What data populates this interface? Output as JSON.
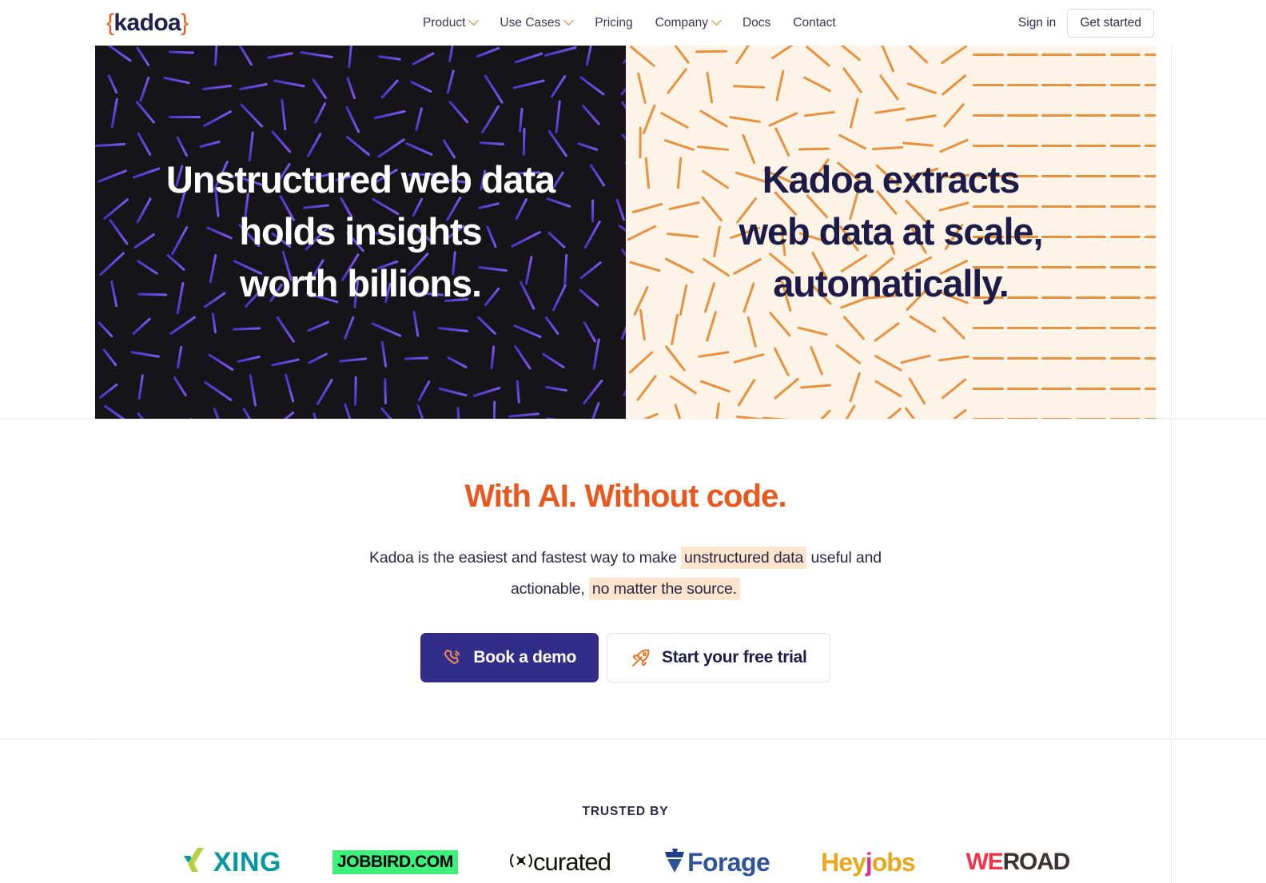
{
  "brand": {
    "logo_open": "{",
    "logo_word": "kadoa",
    "logo_close": "}",
    "accent_orange": "#e8591f",
    "accent_indigo": "#332d8a",
    "navy": "#1d1b47",
    "cream": "#fdf4e7",
    "dark": "#141419",
    "highlight": "#fce4cd"
  },
  "header": {
    "nav": [
      {
        "label": "Product",
        "has_dropdown": true
      },
      {
        "label": "Use Cases",
        "has_dropdown": true
      },
      {
        "label": "Pricing",
        "has_dropdown": false
      },
      {
        "label": "Company",
        "has_dropdown": true
      },
      {
        "label": "Docs",
        "has_dropdown": false
      },
      {
        "label": "Contact",
        "has_dropdown": false
      }
    ],
    "sign_in": "Sign in",
    "get_started": "Get started"
  },
  "hero": {
    "left": {
      "line1": "Unstructured web data",
      "line2": "holds insights",
      "line3": "worth billions."
    },
    "right": {
      "line1": "Kadoa extracts",
      "line2": "web data at scale,",
      "line3": "automatically."
    }
  },
  "mid": {
    "title": "With AI. Without code.",
    "sub_part1": "Kadoa is the easiest and fastest way to make ",
    "sub_hl1": "unstructured data",
    "sub_part2": " useful and actionable, ",
    "sub_hl2": "no matter the source.",
    "primary_cta": "Book a demo",
    "primary_icon": "phone-call-icon",
    "secondary_cta": "Start your free trial",
    "secondary_icon": "rocket-icon"
  },
  "trusted": {
    "label": "TRUSTED BY",
    "logos": [
      {
        "name": "xing",
        "text": "XING"
      },
      {
        "name": "jobbird",
        "text": "JOBBIRD.COM"
      },
      {
        "name": "curated",
        "text": "curated"
      },
      {
        "name": "forage",
        "text": "Forage"
      },
      {
        "name": "heyjobs",
        "text": "Heyjobs",
        "part_a": "Hey",
        "part_b": "j",
        "part_c": "obs"
      },
      {
        "name": "weroad",
        "text": "WEROAD",
        "part_a": "WE",
        "part_b": "ROAD"
      }
    ]
  }
}
